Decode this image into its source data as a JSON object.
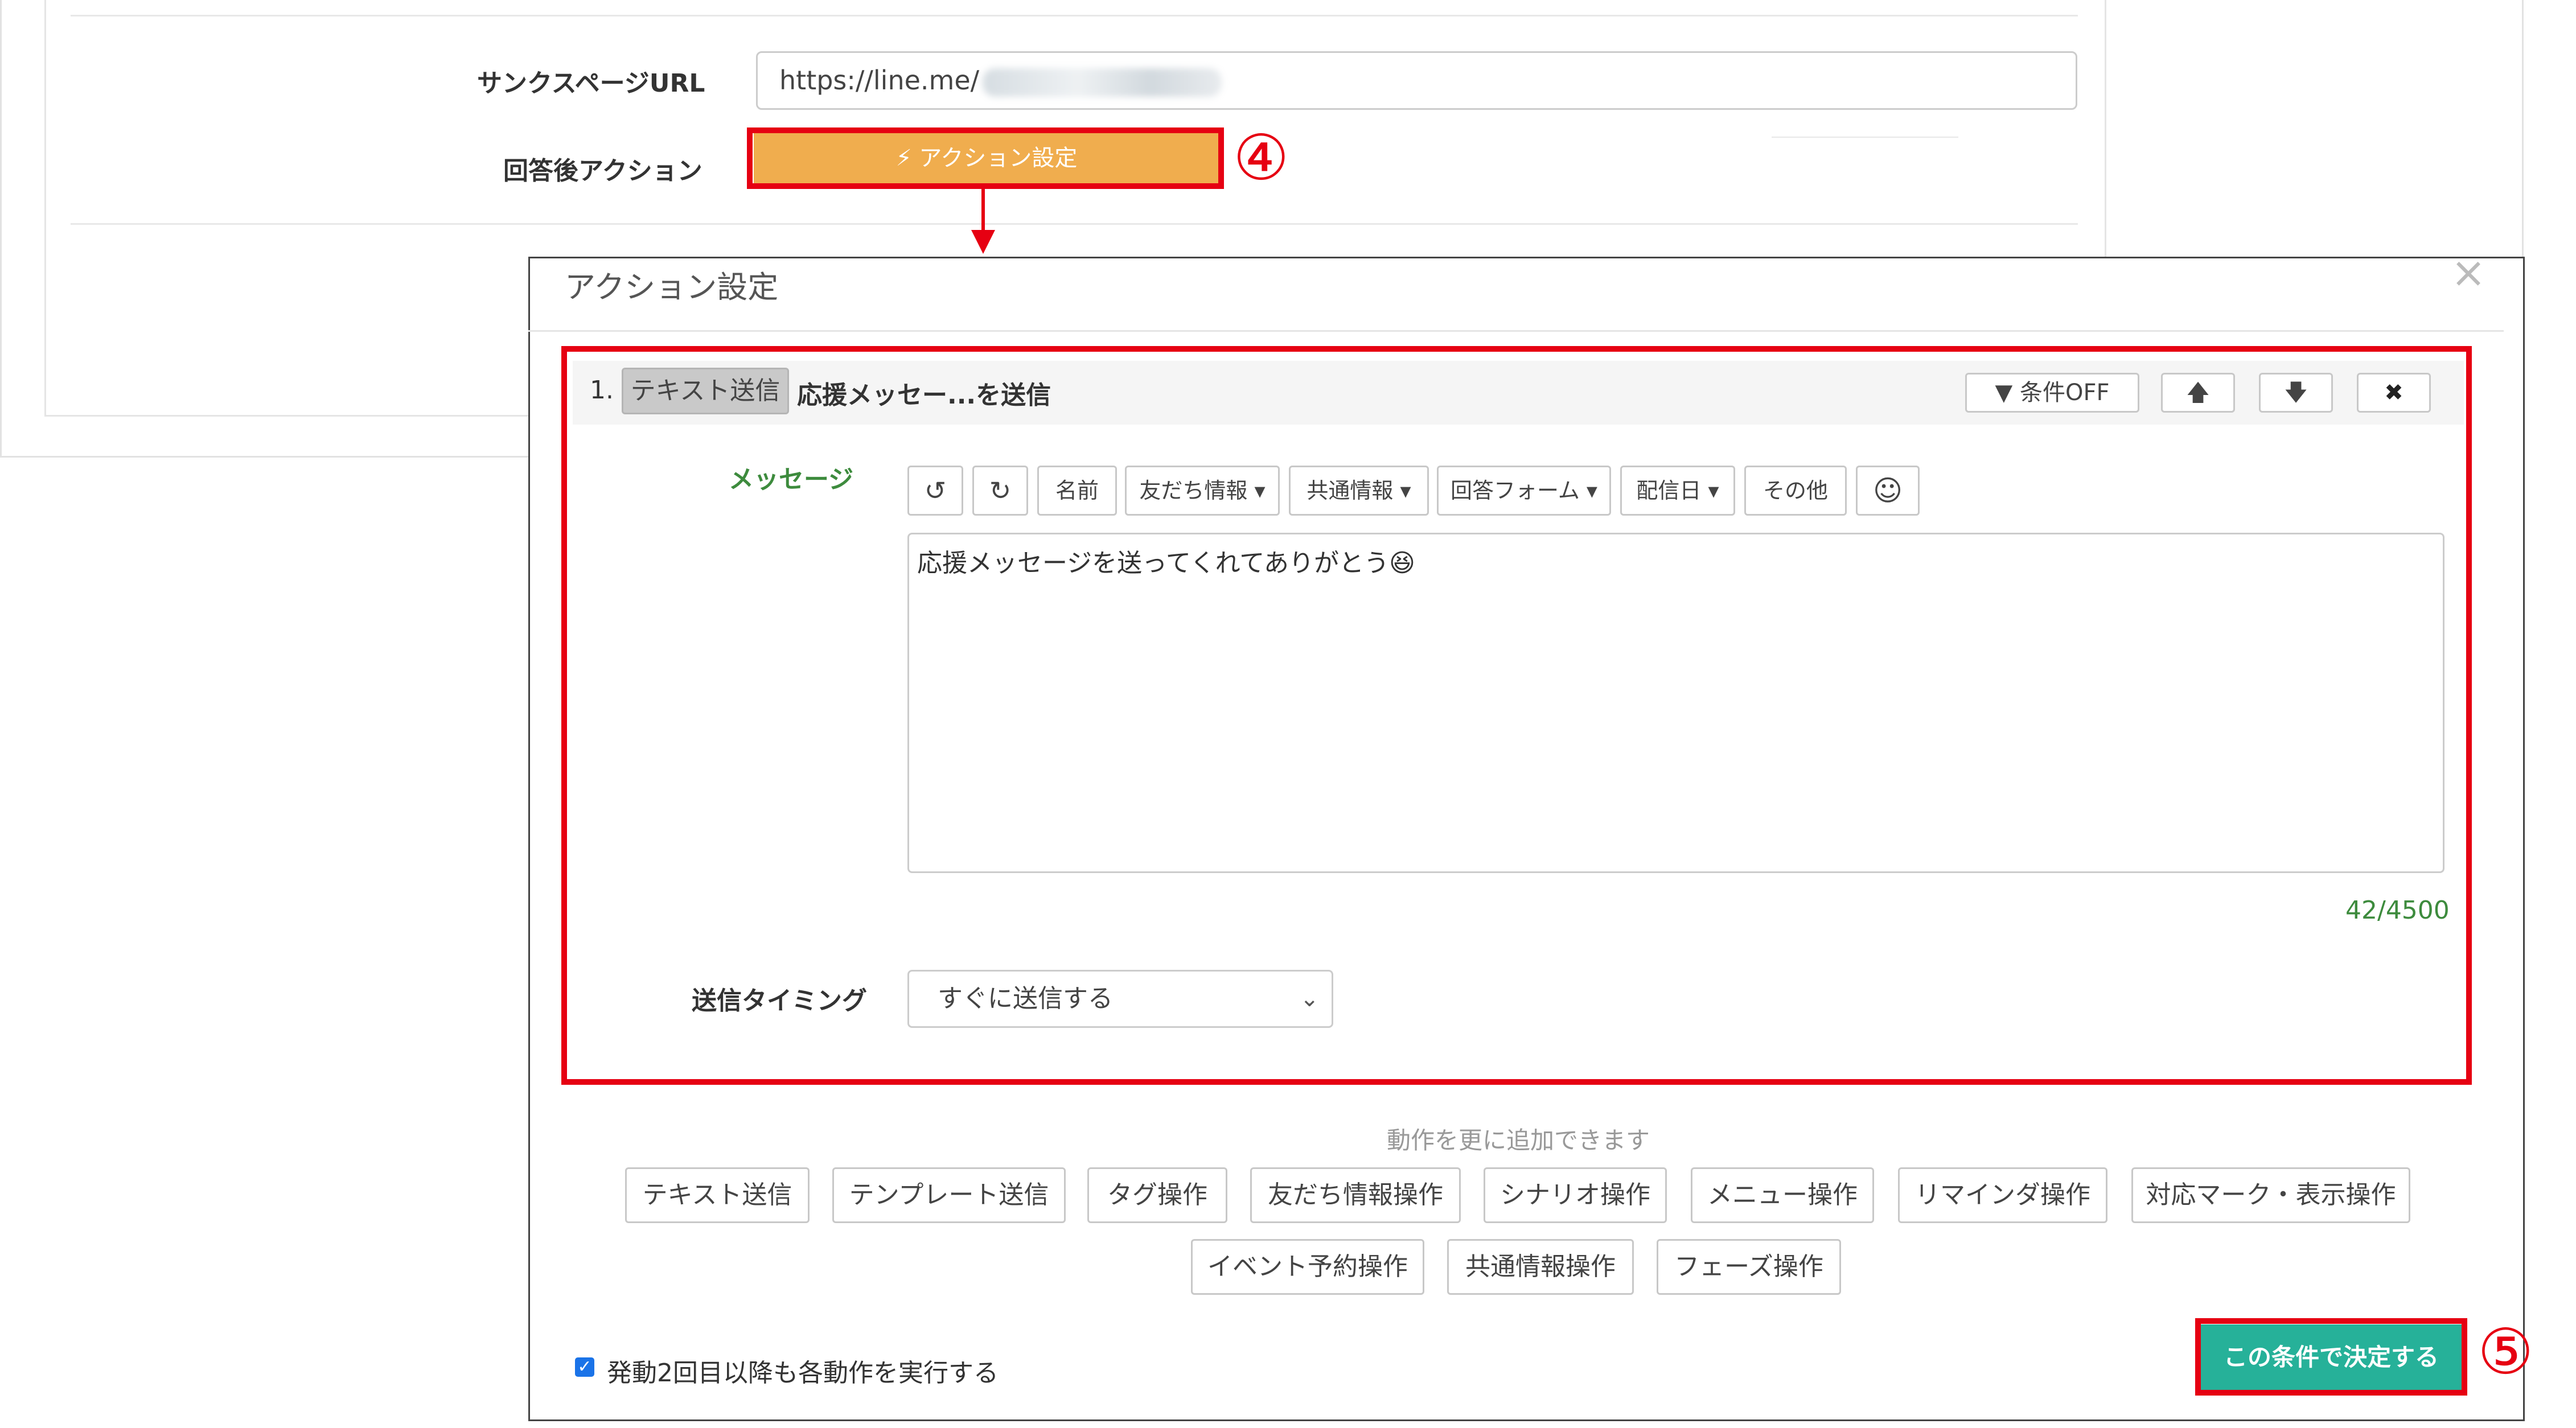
{
  "form": {
    "thanks_url_label": "サンクスページURL",
    "thanks_url_value": "https://line.me/",
    "after_answer_label": "回答後アクション",
    "action_button_icon": "bolt-icon",
    "action_button_label": "⚡ アクション設定"
  },
  "annotations": {
    "step4": "④",
    "step5": "⑤"
  },
  "modal": {
    "title": "アクション設定",
    "close": "×",
    "step": {
      "number": "1.",
      "type": "テキスト送信",
      "title": "応援メッセー...を送信",
      "condition_button": "▼ 条件OFF",
      "up": "🡅",
      "down": "🡇",
      "delete": "✖"
    },
    "message_label": "メッセージ",
    "toolbar": {
      "undo": "↺",
      "redo": "↻",
      "name": "名前",
      "friend_info": "友だち情報 ▾",
      "shared_info": "共通情報 ▾",
      "answer_form": "回答フォーム ▾",
      "delivery_date": "配信日 ▾",
      "other": "その他",
      "emoji": "☺"
    },
    "message_text": "応援メッセージを送ってくれてありがとう😆",
    "char_count": "42/4500",
    "timing_label": "送信タイミング",
    "timing_value": "すぐに送信する",
    "timing_caret": "⌄",
    "add_hint": "動作を更に追加できます",
    "add_buttons": [
      "テキスト送信",
      "テンプレート送信",
      "タグ操作",
      "友だち情報操作",
      "シナリオ操作",
      "メニュー操作",
      "リマインダ操作",
      "対応マーク・表示操作",
      "イベント予約操作",
      "共通情報操作",
      "フェーズ操作"
    ],
    "repeat_checkbox_label": "発動2回目以降も各動作を実行する",
    "repeat_checkbox_checked": true,
    "submit_label": "この条件で決定する"
  },
  "colors": {
    "accent_red": "#e60012",
    "action_orange": "#f0ad4e",
    "submit_teal": "#26b199",
    "label_green": "#3d8b3d"
  }
}
